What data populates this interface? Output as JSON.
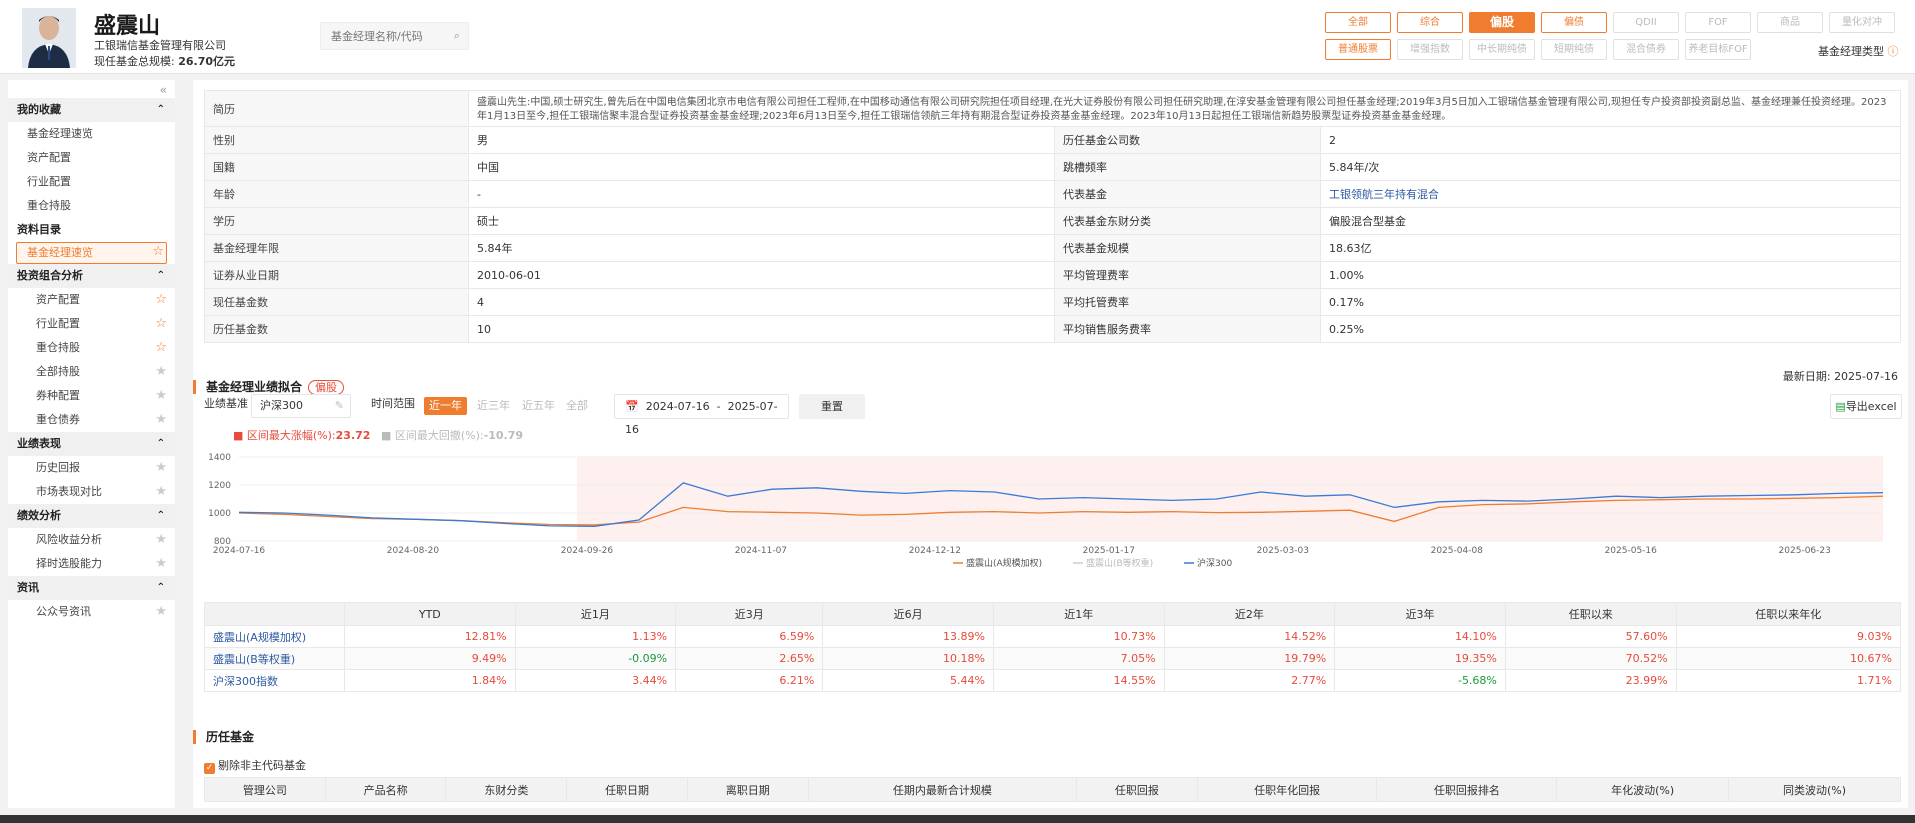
{
  "manager": {
    "name": "盛震山",
    "company": "工银瑞信基金管理有限公司",
    "scale_label": "现任基金总规模:",
    "scale_value": "26.70亿元"
  },
  "search": {
    "placeholder": "基金经理名称/代码"
  },
  "filters": {
    "row1": [
      {
        "label": "全部",
        "state": "on"
      },
      {
        "label": "综合",
        "state": "on"
      },
      {
        "label": "偏股",
        "state": "act"
      },
      {
        "label": "偏债",
        "state": "on"
      },
      {
        "label": "QDII",
        "state": "off"
      },
      {
        "label": "FOF",
        "state": "off"
      },
      {
        "label": "商品",
        "state": "off"
      },
      {
        "label": "量化对冲",
        "state": "off"
      }
    ],
    "row2": [
      {
        "label": "普通股票",
        "state": "on"
      },
      {
        "label": "增强指数",
        "state": "off"
      },
      {
        "label": "中长期纯债",
        "state": "off"
      },
      {
        "label": "短期纯债",
        "state": "off"
      },
      {
        "label": "混合债券",
        "state": "off"
      },
      {
        "label": "养老目标FOF",
        "state": "off"
      }
    ],
    "type_label": "基金经理类型"
  },
  "sidebar": {
    "favorites_title": "我的收藏",
    "favorites": [
      "基金经理速览",
      "资产配置",
      "行业配置",
      "重仓持股"
    ],
    "catalog_title": "资料目录",
    "selected": "基金经理速览",
    "group1": {
      "title": "投资组合分析",
      "items": [
        "资产配置",
        "行业配置",
        "重仓持股",
        "全部持股",
        "券种配置",
        "重仓债券"
      ]
    },
    "group2": {
      "title": "业绩表现",
      "items": [
        "历史回报",
        "市场表现对比"
      ]
    },
    "group3": {
      "title": "绩效分析",
      "items": [
        "风险收益分析",
        "择时选股能力"
      ]
    },
    "group4": {
      "title": "资讯",
      "items": [
        "公众号资讯"
      ]
    }
  },
  "info": {
    "resume_label": "简历",
    "resume": "盛震山先生:中国,硕士研究生,曾先后在中国电信集团北京市电信有限公司担任工程师,在中国移动通信有限公司研究院担任项目经理,在光大证券股份有限公司担任研究助理,在淳安基金管理有限公司担任基金经理;2019年3月5日加入工银瑞信基金管理有限公司,现担任专户投资部投资副总监、基金经理兼任投资经理。2023年1月13日至今,担任工银瑞信聚丰混合型证券投资基金基金经理;2023年6月13日至今,担任工银瑞信领航三年持有期混合型证券投资基金基金经理。2023年10月13日起担任工银瑞信新趋势股票型证券投资基金基金经理。",
    "rows": [
      [
        "性别",
        "男",
        "历任基金公司数",
        "2"
      ],
      [
        "国籍",
        "中国",
        "跳槽频率",
        "5.84年/次"
      ],
      [
        "年龄",
        "-",
        "代表基金",
        "工银领航三年持有混合"
      ],
      [
        "学历",
        "硕士",
        "代表基金东财分类",
        "偏股混合型基金"
      ],
      [
        "基金经理年限",
        "5.84年",
        "代表基金规模",
        "18.63亿"
      ],
      [
        "证券从业日期",
        "2010-06-01",
        "平均管理费率",
        "1.00%"
      ],
      [
        "现任基金数",
        "4",
        "平均托管费率",
        "0.17%"
      ],
      [
        "历任基金数",
        "10",
        "平均销售服务费率",
        "0.25%"
      ]
    ]
  },
  "perf_section": {
    "title": "基金经理业绩拟合",
    "tag": "偏股",
    "latest_label": "最新日期:",
    "latest_date": "2025-07-16",
    "bench_label": "业绩基准",
    "bench_value": "沪深300",
    "range_label": "时间范围",
    "ranges": [
      "近一年",
      "近三年",
      "近五年",
      "全部"
    ],
    "date_from": "2024-07-16",
    "date_sep": "-",
    "date_to": "2025-07-16",
    "reset": "重置",
    "export": "导出excel",
    "max_up_label": "区间最大涨幅(%):",
    "max_up_value": "23.72",
    "max_down_label": "区间最大回撤(%):",
    "max_down_value": "-10.79"
  },
  "chart_data": {
    "type": "line",
    "x_ticks": [
      "2024-07-16",
      "2024-08-20",
      "2024-09-26",
      "2024-11-07",
      "2024-12-12",
      "2025-01-17",
      "2025-03-03",
      "2025-04-08",
      "2025-05-16",
      "2025-06-23"
    ],
    "ylim": [
      800,
      1400
    ],
    "y_ticks": [
      800,
      1000,
      1200,
      1400
    ],
    "series": [
      {
        "name": "盛震山(A规模加权)",
        "color": "#f07c2f",
        "values": [
          1000,
          990,
          975,
          960,
          955,
          945,
          930,
          918,
          915,
          935,
          1040,
          1010,
          1005,
          1000,
          985,
          990,
          1005,
          1010,
          1000,
          1010,
          1005,
          1010,
          1003,
          1005,
          1012,
          1020,
          940,
          1040,
          1060,
          1065,
          1080,
          1090,
          1095,
          1100,
          1100,
          1105,
          1110,
          1120
        ]
      },
      {
        "name": "盛震山(B等权重)",
        "color": "#cccccc",
        "values": []
      },
      {
        "name": "沪深300",
        "color": "#3a7bd5",
        "values": [
          1005,
          1000,
          985,
          965,
          955,
          945,
          925,
          908,
          905,
          950,
          1215,
          1120,
          1170,
          1180,
          1155,
          1140,
          1160,
          1150,
          1100,
          1110,
          1100,
          1090,
          1100,
          1150,
          1120,
          1130,
          1040,
          1080,
          1090,
          1085,
          1100,
          1120,
          1110,
          1120,
          1125,
          1130,
          1140,
          1145
        ]
      }
    ],
    "highlight_range": [
      "2024-09-26",
      "2025-07-16"
    ]
  },
  "perf_table": {
    "headers": [
      "",
      "YTD",
      "近1月",
      "近3月",
      "近6月",
      "近1年",
      "近2年",
      "近3年",
      "任职以来",
      "任职以来年化"
    ],
    "rows": [
      {
        "name": "盛震山(A规模加权)",
        "vals": [
          "12.81%",
          "1.13%",
          "6.59%",
          "13.89%",
          "10.73%",
          "14.52%",
          "14.10%",
          "57.60%",
          "9.03%"
        ]
      },
      {
        "name": "盛震山(B等权重)",
        "vals": [
          "9.49%",
          "-0.09%",
          "2.65%",
          "10.18%",
          "7.05%",
          "19.79%",
          "19.35%",
          "70.52%",
          "10.67%"
        ]
      },
      {
        "name": "沪深300指数",
        "vals": [
          "1.84%",
          "3.44%",
          "6.21%",
          "5.44%",
          "14.55%",
          "2.77%",
          "-5.68%",
          "23.99%",
          "1.71%"
        ]
      }
    ]
  },
  "history": {
    "title": "历任基金",
    "checkbox_label": "剔除非主代码基金",
    "headers": [
      "管理公司",
      "产品名称",
      "东财分类",
      "任职日期",
      "离职日期",
      "任期内最新合计规模",
      "任职回报",
      "任职年化回报",
      "任职回报排名",
      "年化波动(%)",
      "同类波动(%)"
    ]
  }
}
